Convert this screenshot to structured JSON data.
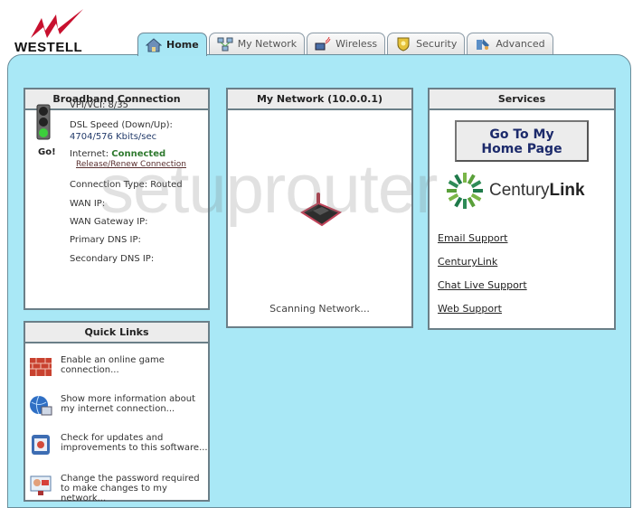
{
  "brand": {
    "name": "WESTELL"
  },
  "tabs": [
    {
      "label": "Home",
      "icon": "home-icon",
      "active": true
    },
    {
      "label": "My Network",
      "icon": "network-icon",
      "active": false
    },
    {
      "label": "Wireless",
      "icon": "wireless-icon",
      "active": false
    },
    {
      "label": "Security",
      "icon": "security-shield-icon",
      "active": false
    },
    {
      "label": "Advanced",
      "icon": "advanced-tools-icon",
      "active": false
    }
  ],
  "broadband": {
    "title": "Broadband Connection",
    "status_icon_label": "Go!",
    "vpi_vci": "VPI/VCI: 8/35",
    "dsl_speed_label": "DSL Speed (Down/Up):",
    "dsl_speed_value": "4704/576 Kbits/sec",
    "internet_label": "Internet:",
    "internet_status": "Connected",
    "release_renew": "Release/Renew Connection",
    "connection_type": "Connection Type: Routed",
    "wan_ip": "WAN IP:",
    "wan_gateway": "WAN Gateway IP:",
    "primary_dns": "Primary DNS IP:",
    "secondary_dns": "Secondary DNS IP:"
  },
  "network": {
    "title": "My Network (10.0.0.1)",
    "status": "Scanning Network..."
  },
  "services": {
    "title": "Services",
    "home_button": "Go To My Home Page",
    "logo_text_a": "Century",
    "logo_text_b": "Link",
    "links": [
      "Email Support",
      "CenturyLink",
      "Chat Live Support",
      "Web Support"
    ]
  },
  "quick_links": {
    "title": "Quick Links",
    "items": [
      {
        "text": "Enable an online game connection...",
        "icon": "firewall-icon"
      },
      {
        "text": "Show more information about my internet connection...",
        "icon": "globe-icon"
      },
      {
        "text": "Check for updates and improvements to this software...",
        "icon": "update-icon"
      },
      {
        "text": "Change the password required to make changes to my network...",
        "icon": "password-icon"
      }
    ]
  },
  "watermark": "setuprouter",
  "colors": {
    "page_bg": "#a9e8f6",
    "connected": "#2f7a2f",
    "button_text": "#1c2a6b"
  }
}
